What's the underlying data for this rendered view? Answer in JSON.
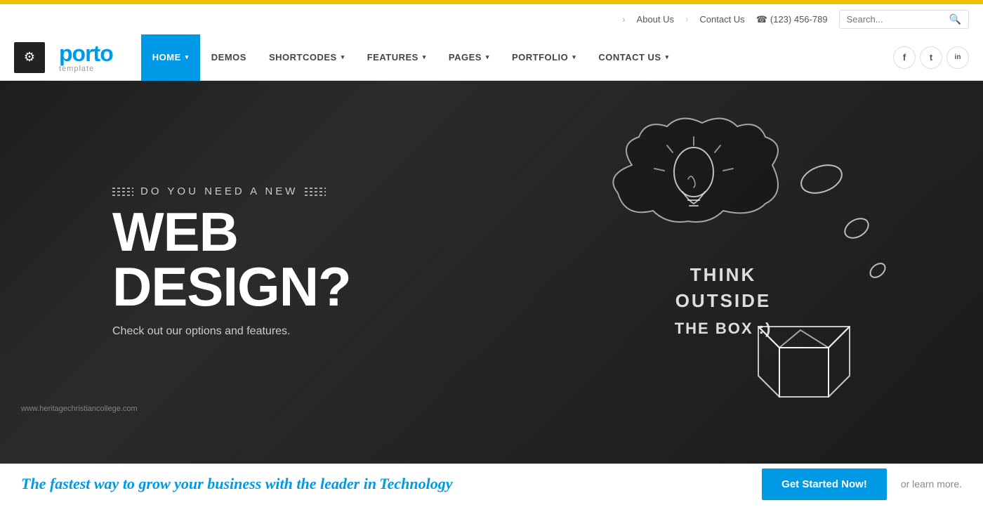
{
  "top_stripe": {},
  "top_bar": {
    "about_link": "About Us",
    "contact_link": "Contact Us",
    "phone_icon": "☎",
    "phone": "(123) 456-789",
    "search_placeholder": "Search...",
    "search_icon": "🔍",
    "chevron": "›"
  },
  "header": {
    "gear_icon": "⚙",
    "logo_text": "porto",
    "logo_sub": "template",
    "nav": [
      {
        "label": "HOME",
        "dropdown": true,
        "active": true
      },
      {
        "label": "DEMOS",
        "dropdown": false,
        "active": false
      },
      {
        "label": "SHORTCODES",
        "dropdown": true,
        "active": false
      },
      {
        "label": "FEATURES",
        "dropdown": true,
        "active": false
      },
      {
        "label": "PAGES",
        "dropdown": true,
        "active": false
      },
      {
        "label": "PORTFOLIO",
        "dropdown": true,
        "active": false
      },
      {
        "label": "CONTACT US",
        "dropdown": true,
        "active": false
      }
    ],
    "social": [
      {
        "icon": "f",
        "name": "facebook"
      },
      {
        "icon": "t",
        "name": "twitter"
      },
      {
        "icon": "in",
        "name": "linkedin"
      }
    ]
  },
  "hero": {
    "eyebrow": "DO YOU NEED A NEW",
    "headline": "WEB DESIGN?",
    "subtext": "Check out our options and features.",
    "chalk_line1": "THINK",
    "chalk_line2": "OUTSIDE",
    "chalk_line3": "THE BOX :)"
  },
  "bottom": {
    "text_before": "The fastest way to grow your business with the leader in",
    "text_highlight": "Technology",
    "text_after": "",
    "cta_label": "Get Started Now!",
    "or_learn": "or learn more."
  },
  "website_url": "www.heritagechristiancollege.com"
}
